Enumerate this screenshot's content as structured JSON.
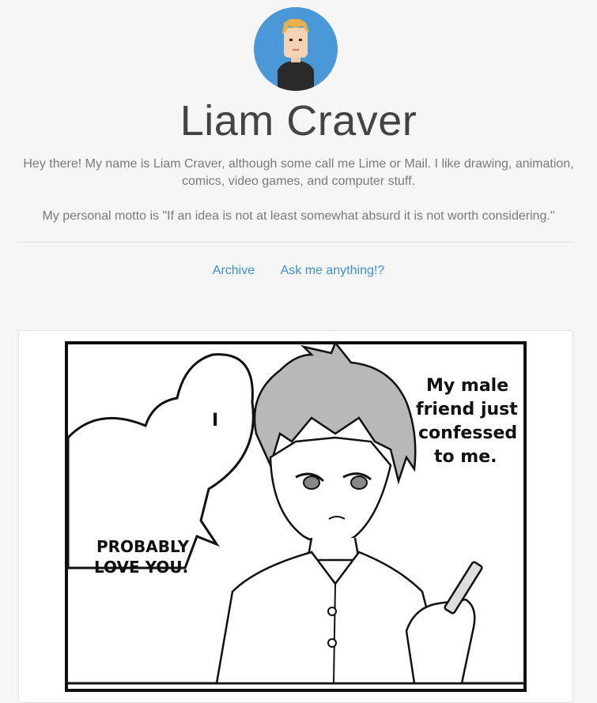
{
  "profile": {
    "avatar_icon": "pixel-portrait-avatar-icon",
    "name": "Liam Craver",
    "bio_line1": "Hey there! My name is Liam Craver, although some call me Lime or Mail. I like drawing, animation, comics, video games, and computer stuff.",
    "motto": "My personal motto is \"If an idea is not at least somewhat absurd it is not worth considering.\""
  },
  "nav": {
    "archive_label": "Archive",
    "ask_label": "Ask me anything!?"
  },
  "post": {
    "comic": {
      "bubble_left_text": "I",
      "speech_lines": [
        "PROBABLY",
        "LOVE YOU."
      ],
      "caption_lines": [
        "My male",
        "friend just",
        "confessed",
        "to me."
      ]
    }
  },
  "colors": {
    "background": "#f6f6f6",
    "avatar_bg": "#4b98d8",
    "link": "#3d8fc9",
    "title": "#444444",
    "bio": "#7a7a7a"
  }
}
